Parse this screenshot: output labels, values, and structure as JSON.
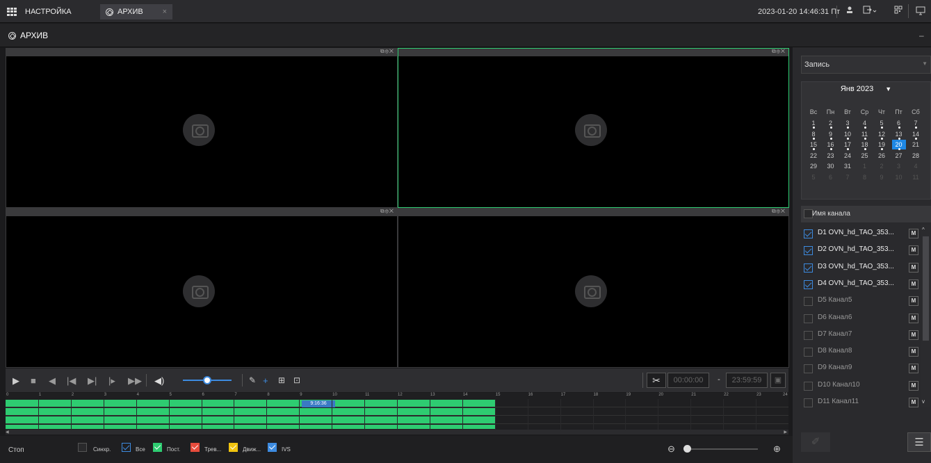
{
  "tabs": {
    "settings": "НАСТРОЙКА",
    "archive": "АРХИВ",
    "close": "×"
  },
  "header": {
    "datetime": "2023-01-20 14:46:31 Пт",
    "title": "АРХИВ",
    "minimize": "– "
  },
  "video": {
    "ctrls": "⧉⊕✕"
  },
  "controls": {
    "time_from": "00:00:00",
    "dash": "-",
    "time_to": "23:59:59"
  },
  "timeline": {
    "ticks": [
      "0",
      "1",
      "2",
      "3",
      "4",
      "5",
      "6",
      "7",
      "8",
      "9",
      "10",
      "11",
      "12",
      "13",
      "14",
      "15",
      "16",
      "17",
      "18",
      "19",
      "20",
      "21",
      "22",
      "23",
      "24"
    ],
    "cursor": "9:16:36",
    "recorded_until_hour": 15
  },
  "volume": {
    "level": 0.5
  },
  "filters": {
    "stop": "Стоп",
    "sync": "Синхр.",
    "all": "Все",
    "const": "Пост.",
    "alarm": "Трев...",
    "motion": "Движ...",
    "ivs": "IVS"
  },
  "colors": {
    "accent": "#3d8be0",
    "recording": "#2ecc71",
    "const": "#2ecc71",
    "alarm": "#e74c3c",
    "motion": "#f1c40f",
    "ivs": "#3d8be0"
  },
  "sidebar": {
    "record_type": "Запись",
    "calendar": {
      "month": "Янв 2023",
      "weekdays": [
        "Вс",
        "Пн",
        "Вт",
        "Ср",
        "Чт",
        "Пт",
        "Сб"
      ],
      "days": [
        "1",
        "2",
        "3",
        "4",
        "5",
        "6",
        "7",
        "8",
        "9",
        "10",
        "11",
        "12",
        "13",
        "14",
        "15",
        "16",
        "17",
        "18",
        "19",
        "20",
        "21",
        "22",
        "23",
        "24",
        "25",
        "26",
        "27",
        "28",
        "29",
        "30",
        "31"
      ],
      "next_days": [
        "1",
        "2",
        "3",
        "4",
        "5",
        "6",
        "7",
        "8",
        "9",
        "10",
        "11"
      ],
      "selected": "20"
    },
    "channel_header": "Имя канала",
    "channels": [
      {
        "label": "D1 OVN_hd_TAO_353...",
        "checked": true
      },
      {
        "label": "D2 OVN_hd_TAO_353...",
        "checked": true
      },
      {
        "label": "D3 OVN_hd_TAO_353...",
        "checked": true
      },
      {
        "label": "D4 OVN_hd_TAO_353...",
        "checked": true
      },
      {
        "label": "D5 Канал5",
        "checked": false
      },
      {
        "label": "D6 Канал6",
        "checked": false
      },
      {
        "label": "D7 Канал7",
        "checked": false
      },
      {
        "label": "D8 Канал8",
        "checked": false
      },
      {
        "label": "D9 Канал9",
        "checked": false
      },
      {
        "label": "D10 Канал10",
        "checked": false
      },
      {
        "label": "D11 Канал11",
        "checked": false
      }
    ],
    "m_label": "M"
  }
}
